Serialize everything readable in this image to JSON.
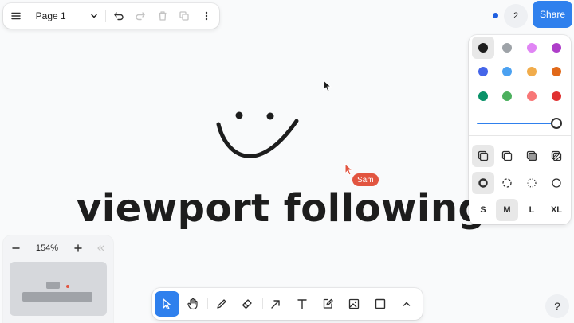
{
  "top_menu": {
    "page_name": "Page 1",
    "menu_icon": "hamburger-icon",
    "chevron_icon": "chevron-down-icon",
    "undo_icon": "undo-icon",
    "redo_icon": "redo-icon",
    "delete_icon": "trash-icon",
    "duplicate_icon": "duplicate-icon",
    "more_icon": "more-vertical-icon"
  },
  "presence": {
    "count": "2",
    "share_label": "Share",
    "dot_color": "#1f5fe0"
  },
  "style_panel": {
    "colors": [
      {
        "name": "black",
        "hex": "#1d1d1d",
        "selected": true
      },
      {
        "name": "grey",
        "hex": "#9ea3a8",
        "selected": false
      },
      {
        "name": "light-violet",
        "hex": "#e085f4",
        "selected": false
      },
      {
        "name": "violet",
        "hex": "#ae3ec9",
        "selected": false
      },
      {
        "name": "blue",
        "hex": "#4465e9",
        "selected": false
      },
      {
        "name": "light-blue",
        "hex": "#4ba1f1",
        "selected": false
      },
      {
        "name": "yellow",
        "hex": "#f1ac4b",
        "selected": false
      },
      {
        "name": "orange",
        "hex": "#e16919",
        "selected": false
      },
      {
        "name": "green",
        "hex": "#099268",
        "selected": false
      },
      {
        "name": "light-green",
        "hex": "#4cb05e",
        "selected": false
      },
      {
        "name": "light-red",
        "hex": "#f87777",
        "selected": false
      },
      {
        "name": "red",
        "hex": "#e03131",
        "selected": false
      }
    ],
    "opacity": 1.0,
    "fill_icons": [
      "fill-none-icon",
      "fill-semi-icon",
      "fill-solid-icon",
      "fill-pattern-icon"
    ],
    "dash_icons": [
      "dash-draw-icon",
      "dash-dashed-icon",
      "dash-dotted-icon",
      "dash-solid-icon"
    ],
    "sizes": [
      "S",
      "M",
      "L",
      "XL"
    ],
    "selected_size": "M"
  },
  "canvas": {
    "text": "viewport following",
    "collaborator_name": "Sam",
    "collaborator_color": "#e25540",
    "accent": "#2f80ed"
  },
  "zoom": {
    "value": "154%",
    "minus_icon": "minus-icon",
    "plus_icon": "plus-icon",
    "collapse_icon": "chevrons-left-icon"
  },
  "toolbar": {
    "tools": [
      "select-icon",
      "hand-icon",
      "draw-icon",
      "eraser-icon",
      "arrow-icon",
      "text-icon",
      "note-icon",
      "image-icon",
      "rectangle-icon",
      "chevron-up-icon"
    ],
    "active_tool": "select"
  },
  "help": {
    "label": "?"
  }
}
